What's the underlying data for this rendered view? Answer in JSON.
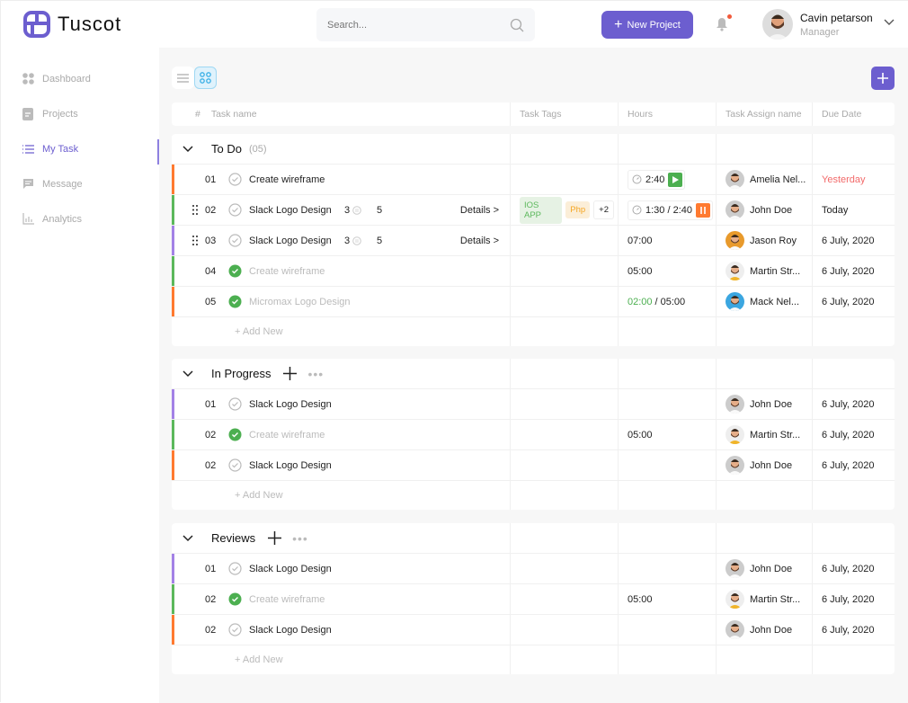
{
  "app": {
    "name": "Tuscot"
  },
  "search": {
    "placeholder": "Search..."
  },
  "header": {
    "new_project_label": "New Project",
    "user_name": "Cavin petarson",
    "user_role": "Manager"
  },
  "sidebar": {
    "items": [
      {
        "label": "Dashboard",
        "icon": "dashboard-icon",
        "active": false
      },
      {
        "label": "Projects",
        "icon": "document-icon",
        "active": false
      },
      {
        "label": "My Task",
        "icon": "list-icon",
        "active": true
      },
      {
        "label": "Message",
        "icon": "message-icon",
        "active": false
      },
      {
        "label": "Analytics",
        "icon": "chart-icon",
        "active": false
      }
    ]
  },
  "columns": {
    "num": "#",
    "name": "Task name",
    "tags": "Task Tags",
    "hours": "Hours",
    "assign": "Task Assign name",
    "due": "Due Date"
  },
  "colors": {
    "accent": "#6c5ecf",
    "orange": "#ff7a30",
    "green": "#5cb85c",
    "purple": "#a381e6",
    "red": "#f26a6a"
  },
  "add_new_label": "+ Add New",
  "groups": [
    {
      "title": "To Do",
      "count": "(05)",
      "actions": false,
      "rows": [
        {
          "num": "01",
          "name": "Create wireframe",
          "done": false,
          "bar": "orange",
          "hours_type": "timer",
          "hours": "2:40",
          "timer_state": "play",
          "assignee": "Amelia Nel...",
          "due": "Yesterday",
          "due_red": true
        },
        {
          "num": "02",
          "name": "Slack Logo Design",
          "done": false,
          "bar": "green",
          "drag": true,
          "comments": "3",
          "subtasks": "5",
          "details": "Details >",
          "tags": [
            "IOS APP",
            "Php",
            "+2"
          ],
          "hours_type": "timer",
          "hours": "1:30 / 2:40",
          "timer_state": "pause",
          "assignee": "John Doe",
          "due": "Today"
        },
        {
          "num": "03",
          "name": "Slack Logo Design",
          "done": false,
          "bar": "purple",
          "drag": true,
          "comments": "3",
          "subtasks": "5",
          "details": "Details >",
          "hours_type": "plain",
          "hours": "07:00",
          "assignee": "Jason Roy",
          "due": "6 July, 2020"
        },
        {
          "num": "04",
          "name": "Create wireframe",
          "done": true,
          "bar": "green",
          "hours_type": "plain",
          "hours": "05:00",
          "assignee": "Martin Str...",
          "due": "6 July, 2020"
        },
        {
          "num": "05",
          "name": "Micromax Logo Design",
          "done": true,
          "bar": "orange",
          "hours_type": "progress",
          "hours_done": "02:00",
          "hours": "/ 05:00",
          "assignee": "Mack Nel...",
          "due": "6 July, 2020"
        }
      ]
    },
    {
      "title": "In Progress",
      "actions": true,
      "rows": [
        {
          "num": "01",
          "name": "Slack Logo Design",
          "done": false,
          "bar": "purple",
          "assignee": "John Doe",
          "due": "6 July, 2020"
        },
        {
          "num": "02",
          "name": "Create wireframe",
          "done": true,
          "bar": "green",
          "hours_type": "plain",
          "hours": "05:00",
          "assignee": "Martin Str...",
          "due": "6 July, 2020"
        },
        {
          "num": "02",
          "name": "Slack Logo Design",
          "done": false,
          "bar": "orange",
          "assignee": "John Doe",
          "due": "6 July, 2020"
        }
      ]
    },
    {
      "title": "Reviews",
      "actions": true,
      "rows": [
        {
          "num": "01",
          "name": "Slack Logo Design",
          "done": false,
          "bar": "purple",
          "assignee": "John Doe",
          "due": "6 July, 2020"
        },
        {
          "num": "02",
          "name": "Create wireframe",
          "done": true,
          "bar": "green",
          "hours_type": "plain",
          "hours": "05:00",
          "assignee": "Martin Str...",
          "due": "6 July, 2020"
        },
        {
          "num": "02",
          "name": "Slack Logo Design",
          "done": false,
          "bar": "orange",
          "assignee": "John Doe",
          "due": "6 July, 2020"
        }
      ]
    }
  ]
}
